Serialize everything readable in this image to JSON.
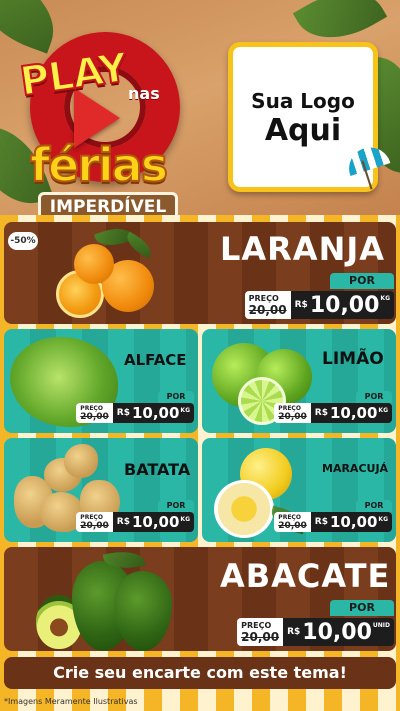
{
  "header": {
    "campaign_word_1": "PLAY",
    "campaign_word_2": "nas",
    "campaign_word_3": "férias",
    "campaign_ribbon": "IMPERDÍVEL",
    "logo_line_1": "Sua Logo",
    "logo_line_2": "Aqui"
  },
  "products": [
    {
      "name": "LARANJA",
      "badge": "-50%",
      "price_label": "PREÇO",
      "old_price": "20,00",
      "por_label": "POR",
      "currency": "R$",
      "price": "10,00",
      "unit": "KG"
    },
    {
      "name": "ALFACE",
      "price_label": "PREÇO",
      "old_price": "20,00",
      "por_label": "POR",
      "currency": "R$",
      "price": "10,00",
      "unit": "KG"
    },
    {
      "name": "LIMÃO",
      "price_label": "PREÇO",
      "old_price": "20,00",
      "por_label": "POR",
      "currency": "R$",
      "price": "10,00",
      "unit": "KG"
    },
    {
      "name": "BATATA",
      "price_label": "PREÇO",
      "old_price": "20,00",
      "por_label": "POR",
      "currency": "R$",
      "price": "10,00",
      "unit": "KG"
    },
    {
      "name": "MARACUJÁ",
      "price_label": "PREÇO",
      "old_price": "20,00",
      "por_label": "POR",
      "currency": "R$",
      "price": "10,00",
      "unit": "KG"
    },
    {
      "name": "ABACATE",
      "price_label": "PREÇO",
      "old_price": "20,00",
      "por_label": "POR",
      "currency": "R$",
      "price": "10,00",
      "unit": "UNID"
    }
  ],
  "footer": {
    "cta": "Crie seu encarte com este tema!",
    "disclaimer": "*Imagens Meramente Ilustrativas"
  },
  "colors": {
    "brown": "#7a3d1d",
    "teal": "#2bb7a6",
    "yellow": "#f4b526",
    "red": "#c8141b",
    "price_black": "#1d1d1d"
  },
  "icons": [
    "orange-illustration",
    "lettuce-illustration",
    "lime-illustration",
    "potato-illustration",
    "passion-fruit-illustration",
    "avocado-illustration",
    "beach-umbrella-icon",
    "swim-ring-illustration"
  ]
}
